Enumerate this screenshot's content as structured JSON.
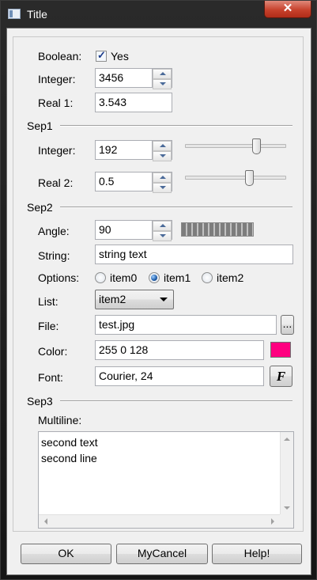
{
  "window": {
    "title": "Title",
    "close_label": "✕"
  },
  "form": {
    "boolean": {
      "label": "Boolean:",
      "check_label": "Yes",
      "checked": true
    },
    "integer": {
      "label": "Integer:",
      "value": "3456"
    },
    "real1": {
      "label": "Real 1:",
      "value": "3.543"
    },
    "sep1": {
      "label": "Sep1"
    },
    "integer2": {
      "label": "Integer:",
      "value": "192"
    },
    "real2": {
      "label": "Real 2:",
      "value": "0.5"
    },
    "sep2": {
      "label": "Sep2"
    },
    "angle": {
      "label": "Angle:",
      "value": "90"
    },
    "string": {
      "label": "String:",
      "value": "string text"
    },
    "options": {
      "label": "Options:",
      "items": [
        "item0",
        "item1",
        "item2"
      ],
      "selected": "item1"
    },
    "list": {
      "label": "List:",
      "value": "item2"
    },
    "file": {
      "label": "File:",
      "value": "test.jpg",
      "browse_label": "..."
    },
    "color": {
      "label": "Color:",
      "value": "255 0 128",
      "swatch": "#ff0080"
    },
    "font": {
      "label": "Font:",
      "value": "Courier, 24",
      "button_label": "F"
    },
    "sep3": {
      "label": "Sep3"
    },
    "multiline": {
      "label": "Multiline:",
      "lines": [
        "second text",
        "second line"
      ]
    }
  },
  "buttons": {
    "ok": "OK",
    "cancel": "MyCancel",
    "help": "Help!"
  }
}
